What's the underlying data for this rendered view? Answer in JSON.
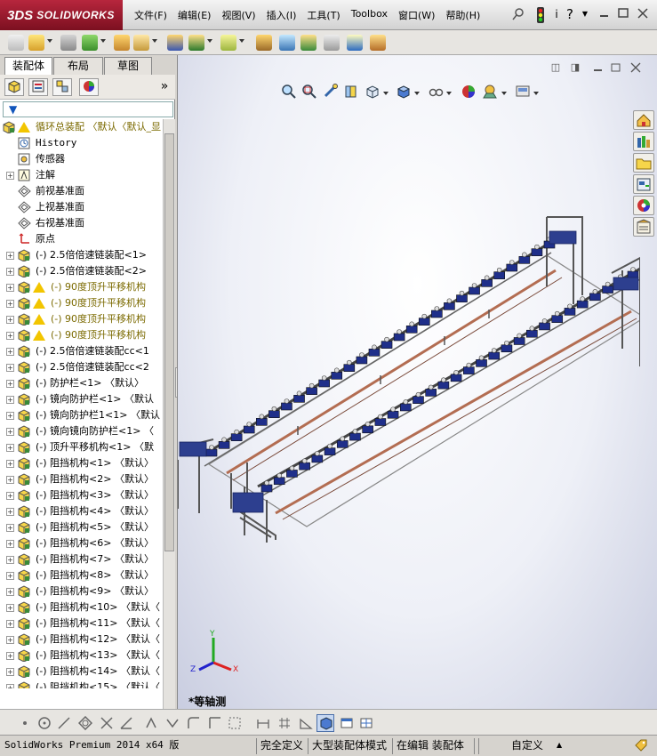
{
  "app": {
    "ds_logo": "3DS",
    "name": "SOLIDWORKS"
  },
  "menu": [
    "文件(F)",
    "编辑(E)",
    "视图(V)",
    "插入(I)",
    "工具(T)",
    "Toolbox",
    "窗口(W)",
    "帮助(H)"
  ],
  "title_icons": {
    "help_char": "i",
    "question_char": "?"
  },
  "tabs": [
    "装配体",
    "布局",
    "草图"
  ],
  "fm_tabs_more": "»",
  "filter_symbol": "▼",
  "tree": [
    {
      "label": "循环总装配  〈默认〈默认_显",
      "warn": true,
      "color": "#7b6a00",
      "icon": "assembly"
    },
    {
      "label": "History",
      "icon": "history",
      "mono": true
    },
    {
      "label": "传感器",
      "icon": "sensor"
    },
    {
      "label": "注解",
      "icon": "annotation",
      "expand": true
    },
    {
      "label": "前视基准面",
      "icon": "plane"
    },
    {
      "label": "上视基准面",
      "icon": "plane"
    },
    {
      "label": "右视基准面",
      "icon": "plane"
    },
    {
      "label": "原点",
      "icon": "origin"
    },
    {
      "label": "(-) 2.5倍倍速链装配<1>",
      "icon": "assembly",
      "expand": true
    },
    {
      "label": "(-) 2.5倍倍速链装配<2>",
      "icon": "assembly",
      "expand": true
    },
    {
      "label": "(-) 90度顶升平移机构",
      "icon": "assembly",
      "expand": true,
      "warn": true,
      "color": "#7b6a00"
    },
    {
      "label": "(-) 90度顶升平移机构",
      "icon": "assembly",
      "expand": true,
      "warn": true,
      "color": "#7b6a00"
    },
    {
      "label": "(-) 90度顶升平移机构",
      "icon": "assembly",
      "expand": true,
      "warn": true,
      "color": "#7b6a00"
    },
    {
      "label": "(-) 90度顶升平移机构",
      "icon": "assembly",
      "expand": true,
      "warn": true,
      "color": "#7b6a00"
    },
    {
      "label": "(-) 2.5倍倍速链装配cc<1",
      "icon": "assembly",
      "expand": true
    },
    {
      "label": "(-) 2.5倍倍速链装配cc<2",
      "icon": "assembly",
      "expand": true
    },
    {
      "label": "(-) 防护栏<1> 〈默认〉",
      "icon": "assembly",
      "expand": true
    },
    {
      "label": "(-) 镜向防护栏<1> 〈默认",
      "icon": "assembly",
      "expand": true
    },
    {
      "label": "(-) 镜向防护栏1<1> 〈默认",
      "icon": "assembly",
      "expand": true
    },
    {
      "label": "(-) 镜向镜向防护栏<1> 〈",
      "icon": "assembly",
      "expand": true
    },
    {
      "label": "(-) 顶升平移机构<1> 〈默",
      "icon": "assembly",
      "expand": true
    },
    {
      "label": "(-) 阻挡机构<1> 〈默认〉",
      "icon": "assembly",
      "expand": true
    },
    {
      "label": "(-) 阻挡机构<2> 〈默认〉",
      "icon": "assembly",
      "expand": true
    },
    {
      "label": "(-) 阻挡机构<3> 〈默认〉",
      "icon": "assembly",
      "expand": true
    },
    {
      "label": "(-) 阻挡机构<4> 〈默认〉",
      "icon": "assembly",
      "expand": true
    },
    {
      "label": "(-) 阻挡机构<5> 〈默认〉",
      "icon": "assembly",
      "expand": true
    },
    {
      "label": "(-) 阻挡机构<6> 〈默认〉",
      "icon": "assembly",
      "expand": true
    },
    {
      "label": "(-) 阻挡机构<7> 〈默认〉",
      "icon": "assembly",
      "expand": true
    },
    {
      "label": "(-) 阻挡机构<8> 〈默认〉",
      "icon": "assembly",
      "expand": true
    },
    {
      "label": "(-) 阻挡机构<9> 〈默认〉",
      "icon": "assembly",
      "expand": true
    },
    {
      "label": "(-) 阻挡机构<10> 〈默认〈",
      "icon": "assembly",
      "expand": true
    },
    {
      "label": "(-) 阻挡机构<11> 〈默认〈",
      "icon": "assembly",
      "expand": true
    },
    {
      "label": "(-) 阻挡机构<12> 〈默认〈",
      "icon": "assembly",
      "expand": true
    },
    {
      "label": "(-) 阻挡机构<13> 〈默认〈",
      "icon": "assembly",
      "expand": true
    },
    {
      "label": "(-) 阻挡机构<14> 〈默认〈",
      "icon": "assembly",
      "expand": true
    },
    {
      "label": "(-) 阻挡机构<15> 〈默认〈",
      "icon": "assembly",
      "expand": true
    }
  ],
  "viewport": {
    "orientation": "*等轴测",
    "triad": {
      "x": "X",
      "y": "Y",
      "z": "Z"
    }
  },
  "status": {
    "product": "SolidWorks Premium 2014 x64 版",
    "defined": "完全定义",
    "mode": "大型装配体模式",
    "editing": "在编辑 装配体",
    "units": "自定义",
    "caret": "▲"
  },
  "colors": {
    "accent": "#b7263d",
    "conveyor_blue": "#1f2f8a",
    "frame": "#6a6a6a",
    "rail": "#b36d52"
  }
}
